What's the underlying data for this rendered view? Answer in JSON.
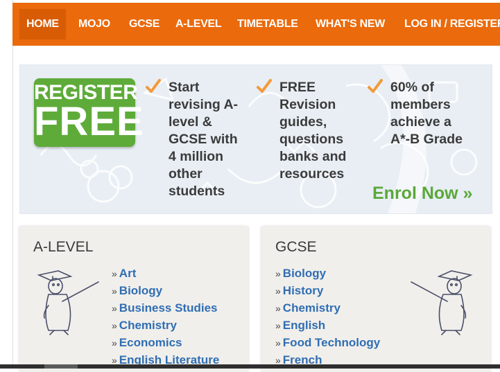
{
  "nav": {
    "items": [
      {
        "label": "HOME",
        "active": true
      },
      {
        "label": "MOJO"
      },
      {
        "label": "GCSE"
      },
      {
        "label": "A-LEVEL"
      },
      {
        "label": "TIMETABLE"
      },
      {
        "label": "WHAT'S NEW"
      },
      {
        "label": "LOG IN / REGISTER"
      }
    ]
  },
  "banner": {
    "badge_top": "REGISTER",
    "badge_big": "FREE",
    "features": [
      [
        "Start",
        "revising A-",
        "level &",
        "GCSE with",
        "4 million",
        "other",
        "students"
      ],
      [
        "FREE",
        "Revision",
        "guides,",
        "questions",
        "banks and",
        "resources"
      ],
      [
        "60% of",
        "members",
        "achieve a",
        "A*-B Grade"
      ]
    ],
    "enrol": "Enrol Now »"
  },
  "alevel": {
    "title": "A-LEVEL",
    "subjects": [
      "Art",
      "Biology",
      "Business Studies",
      "Chemistry",
      "Economics",
      "English Literature"
    ]
  },
  "gcse": {
    "title": "GCSE",
    "subjects": [
      "Biology",
      "History",
      "Chemistry",
      "English",
      "Food Technology",
      "French"
    ]
  },
  "colors": {
    "nav": "#ea6a0c",
    "badge": "#5eab3a",
    "check": "#f39a3a",
    "link": "#2f6eb3",
    "enrol": "#5aa83a"
  },
  "icons": [
    "check-icon",
    "graduate-doodle-icon"
  ]
}
